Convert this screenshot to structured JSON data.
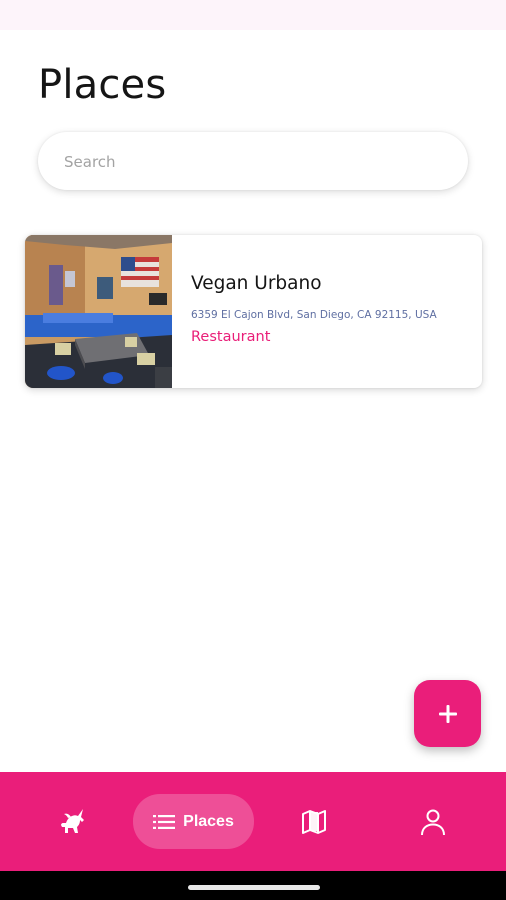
{
  "page": {
    "title": "Places"
  },
  "search": {
    "placeholder": "Search",
    "value": ""
  },
  "places": [
    {
      "name": "Vegan Urbano",
      "address": "6359 El Cajon Blvd, San Diego, CA 92115, USA",
      "category": "Restaurant",
      "photo": "restaurant-interior-photo"
    }
  ],
  "fab": {
    "icon": "plus-icon"
  },
  "bottom_nav": {
    "items": [
      {
        "icon": "unicorn-icon",
        "label": ""
      },
      {
        "icon": "list-icon",
        "label": "Places",
        "active": true
      },
      {
        "icon": "map-icon",
        "label": ""
      },
      {
        "icon": "person-icon",
        "label": ""
      }
    ]
  },
  "colors": {
    "accent": "#ea1e7a",
    "category_text": "#e91e78",
    "address_text": "#5f6fa2"
  }
}
